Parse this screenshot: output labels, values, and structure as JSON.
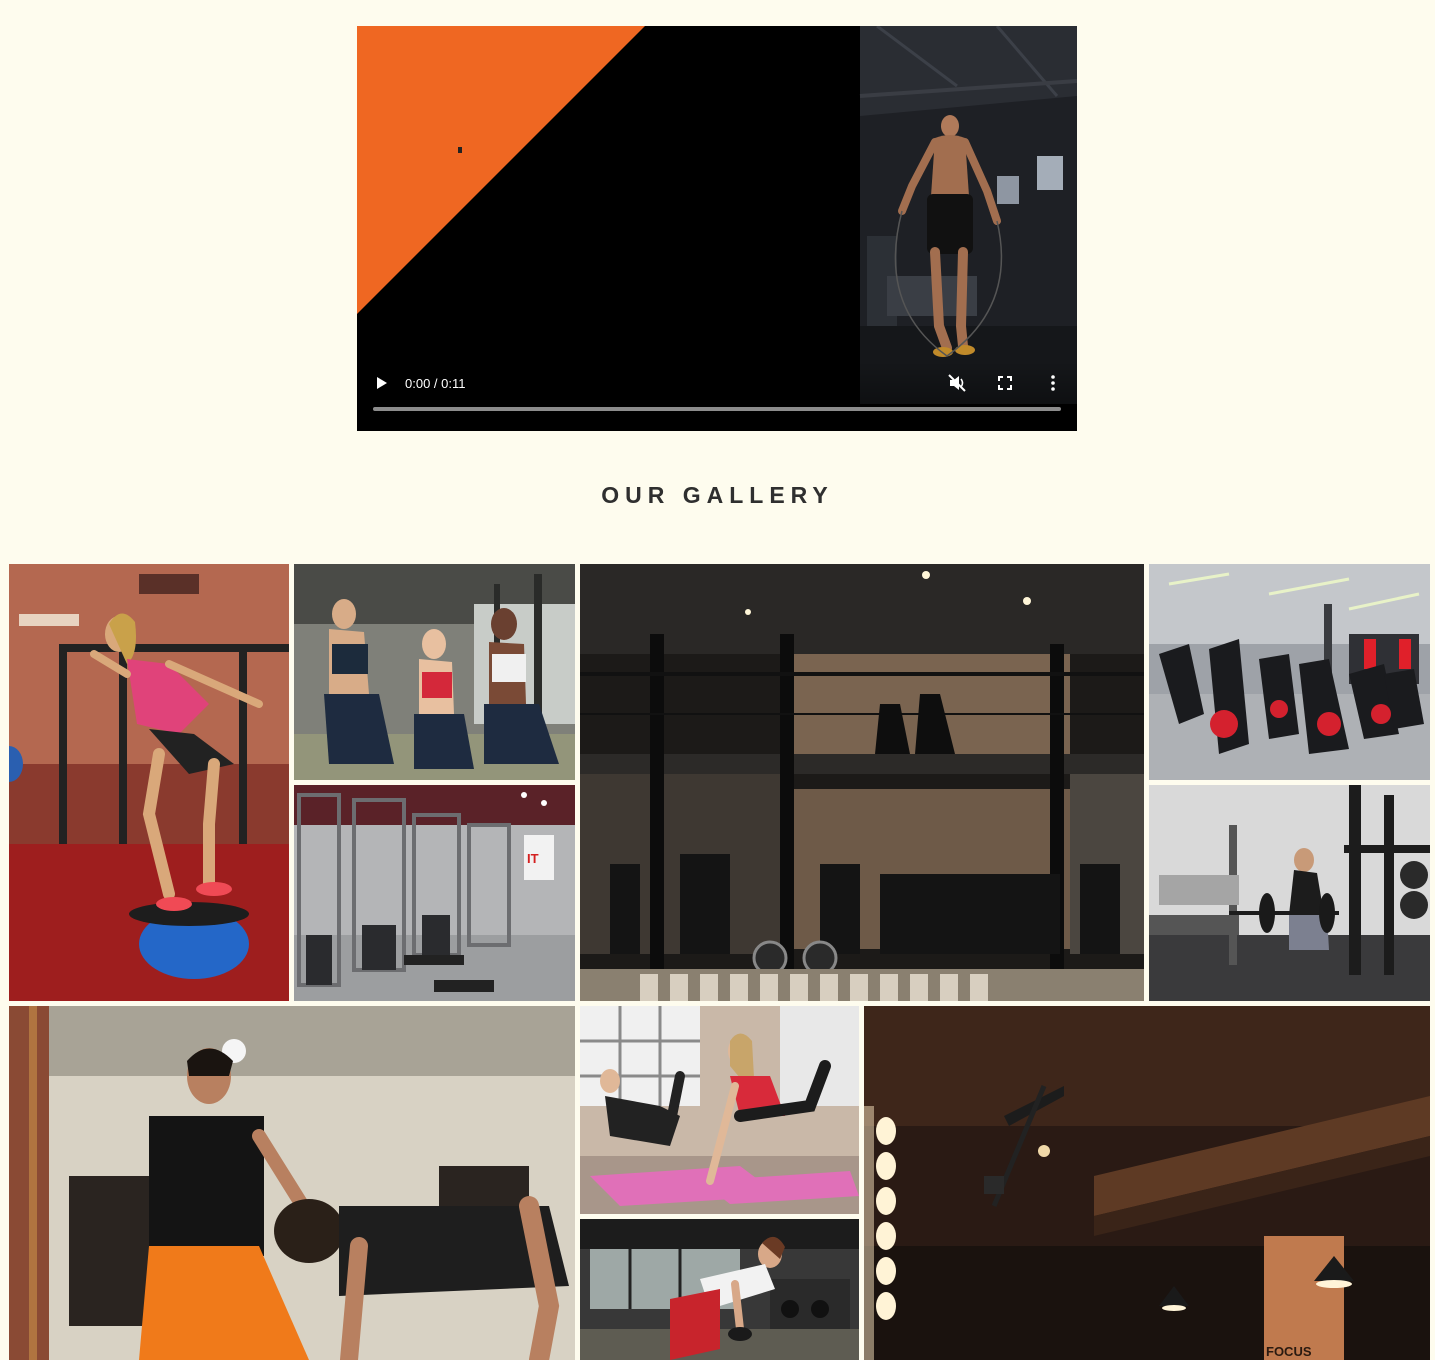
{
  "video": {
    "time_label": "0:00 / 0:11",
    "progress": 0,
    "icons": {
      "play": "play-icon",
      "mute": "volume-muted-icon",
      "fullscreen": "fullscreen-icon",
      "more": "more-vert-icon"
    },
    "accent_color": "#ef6722"
  },
  "gallery": {
    "title": "OUR GALLERY"
  }
}
